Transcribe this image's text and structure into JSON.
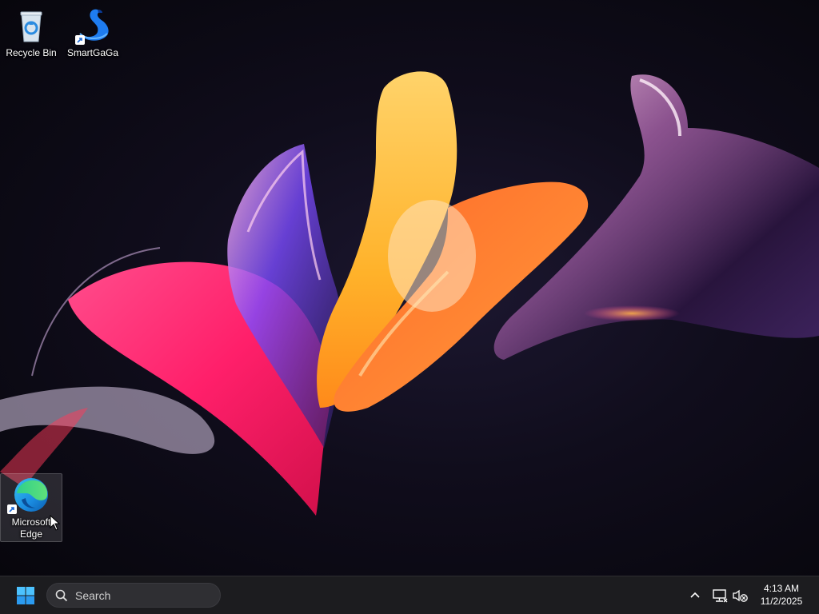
{
  "desktop": {
    "icons": [
      {
        "label": "Recycle Bin",
        "icon": "recycle-bin-icon"
      },
      {
        "label": "SmartGaGa",
        "icon": "smartgaga-swan-icon"
      },
      {
        "label": "Microsoft Edge",
        "icon": "edge-icon"
      }
    ]
  },
  "taskbar": {
    "start_icon": "windows-start-icon",
    "search_placeholder": "Search",
    "tray": {
      "chevron_icon": "chevron-up-icon",
      "network_icon": "network-icon",
      "volume_icon": "volume-muted-icon"
    },
    "clock": {
      "time": "4:13 AM",
      "date": "11/2/2025"
    }
  },
  "colors": {
    "taskbar_bg": "#1c1c1f",
    "accent_blue": "#3aa0ff",
    "wallpaper_pink": "#ff2d7a",
    "wallpaper_orange": "#ff8a2a",
    "wallpaper_yellow": "#ffc23a",
    "wallpaper_purple": "#6a3cff"
  }
}
